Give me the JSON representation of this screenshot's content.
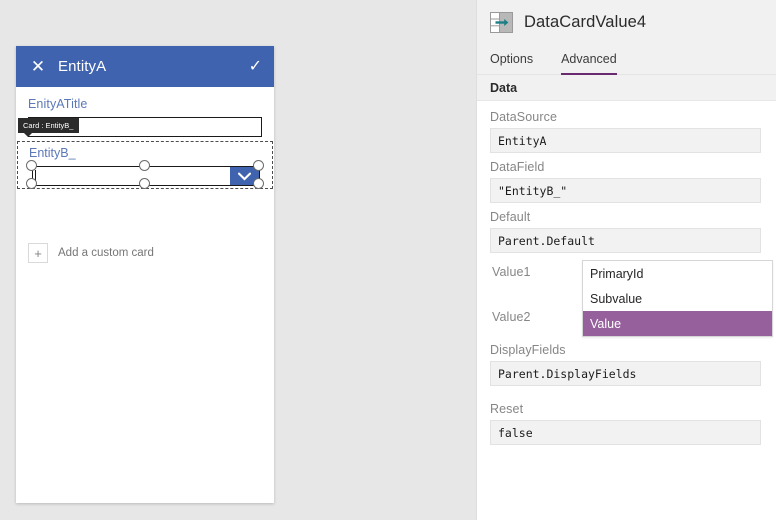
{
  "colors": {
    "form_header_blue": "#3f63ae",
    "card_label_blue": "#5b78b8",
    "tab_underline_purple": "#692a70",
    "dropdown_selected_purple": "#96609c",
    "canvas_gray": "#e7e7e7",
    "panel_head_gray": "#f1f1f1",
    "field_gray": "#f2f2f2",
    "tooltip_dark": "#2b2b2b",
    "icon_teal": "#1d7f85"
  },
  "canvas": {
    "form": {
      "header": {
        "close_icon": "close-icon",
        "title": "EntityA",
        "confirm_icon": "checkmark-icon"
      },
      "cards": [
        {
          "label": "EnityATitle",
          "input_value": "",
          "input_placeholder": ""
        },
        {
          "label": "EntityB_",
          "input_value": "",
          "input_placeholder": "",
          "dropdown_icon": "chevron-down-icon",
          "selected": true
        }
      ],
      "add_custom_card": {
        "plus_icon": "plus-icon",
        "label": "Add a custom card"
      }
    },
    "tooltip": {
      "text": "Card : EntityB_"
    }
  },
  "properties_panel": {
    "header": {
      "control_icon": "combobox-control-icon",
      "title": "DataCardValue4"
    },
    "tabs": [
      {
        "label": "Options",
        "active": false
      },
      {
        "label": "Advanced",
        "active": true
      }
    ],
    "section": {
      "title": "Data"
    },
    "fields": [
      {
        "label": "DataSource",
        "value": "EntityA"
      },
      {
        "label": "DataField",
        "value": "\"EntityB_\""
      },
      {
        "label": "Default",
        "value": "Parent.Default"
      }
    ],
    "value_rows": [
      {
        "label": "Value1"
      },
      {
        "label": "Value2"
      }
    ],
    "dropdown": {
      "items": [
        {
          "label": "PrimaryId",
          "selected": false
        },
        {
          "label": "Subvalue",
          "selected": false
        },
        {
          "label": "Value",
          "selected": true
        }
      ]
    },
    "fields_after": [
      {
        "label": "DisplayFields",
        "value": "Parent.DisplayFields"
      },
      {
        "label": "Reset",
        "value": "false"
      }
    ]
  }
}
